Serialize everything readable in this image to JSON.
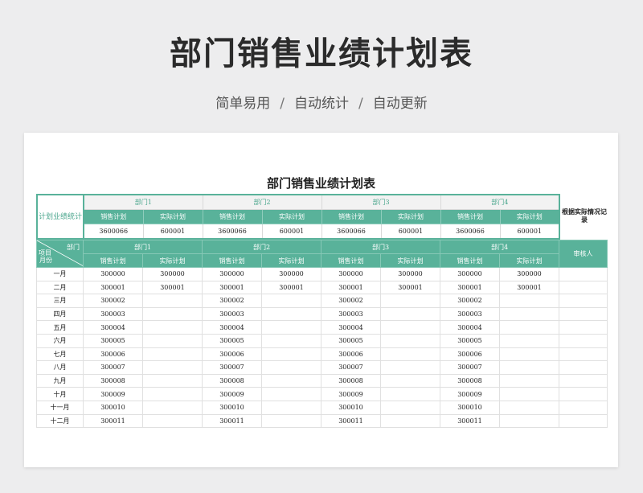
{
  "hero": {
    "title": "部门销售业绩计划表",
    "subtitle_parts": [
      "简单易用",
      "自动统计",
      "自动更新"
    ],
    "separator": "/"
  },
  "sheet": {
    "title": "部门销售业绩计划表",
    "plan_label": "计划业绩统计",
    "note": "根据实际情况记录",
    "departments": [
      "部门1",
      "部门2",
      "部门3",
      "部门4"
    ],
    "col_plan": "销售计划",
    "col_actual": "实际计划",
    "plan_values": [
      [
        "3600066",
        "600001"
      ],
      [
        "3600066",
        "600001"
      ],
      [
        "3600066",
        "600001"
      ],
      [
        "3600066",
        "600001"
      ]
    ],
    "diag_top": "部门",
    "diag_mid": "项目",
    "diag_bottom": "月份",
    "reviewer": "审核人",
    "rows": [
      {
        "month": "一月",
        "cells": [
          "300000",
          "300000",
          "300000",
          "300000",
          "300000",
          "300000",
          "300000",
          "300000"
        ]
      },
      {
        "month": "二月",
        "cells": [
          "300001",
          "300001",
          "300001",
          "300001",
          "300001",
          "300001",
          "300001",
          "300001"
        ]
      },
      {
        "month": "三月",
        "cells": [
          "300002",
          "",
          "300002",
          "",
          "300002",
          "",
          "300002",
          ""
        ]
      },
      {
        "month": "四月",
        "cells": [
          "300003",
          "",
          "300003",
          "",
          "300003",
          "",
          "300003",
          ""
        ]
      },
      {
        "month": "五月",
        "cells": [
          "300004",
          "",
          "300004",
          "",
          "300004",
          "",
          "300004",
          ""
        ]
      },
      {
        "month": "六月",
        "cells": [
          "300005",
          "",
          "300005",
          "",
          "300005",
          "",
          "300005",
          ""
        ]
      },
      {
        "month": "七月",
        "cells": [
          "300006",
          "",
          "300006",
          "",
          "300006",
          "",
          "300006",
          ""
        ]
      },
      {
        "month": "八月",
        "cells": [
          "300007",
          "",
          "300007",
          "",
          "300007",
          "",
          "300007",
          ""
        ]
      },
      {
        "month": "九月",
        "cells": [
          "300008",
          "",
          "300008",
          "",
          "300008",
          "",
          "300008",
          ""
        ]
      },
      {
        "month": "十月",
        "cells": [
          "300009",
          "",
          "300009",
          "",
          "300009",
          "",
          "300009",
          ""
        ]
      },
      {
        "month": "十一月",
        "cells": [
          "300010",
          "",
          "300010",
          "",
          "300010",
          "",
          "300010",
          ""
        ]
      },
      {
        "month": "十二月",
        "cells": [
          "300011",
          "",
          "300011",
          "",
          "300011",
          "",
          "300011",
          ""
        ]
      }
    ]
  }
}
